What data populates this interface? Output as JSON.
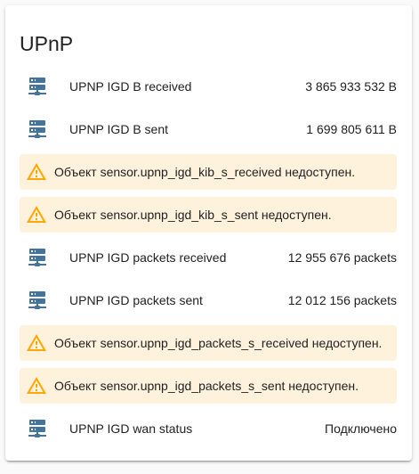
{
  "card": {
    "title": "UPnP"
  },
  "rows": [
    {
      "type": "entity",
      "icon": "server-network-icon",
      "label": "UPNP IGD B received",
      "value": "3 865 933 532 B"
    },
    {
      "type": "entity",
      "icon": "server-network-icon",
      "label": "UPNP IGD B sent",
      "value": "1 699 805 611 B"
    },
    {
      "type": "warning",
      "icon": "alert-triangle-icon",
      "text": "Объект sensor.upnp_igd_kib_s_received недоступен."
    },
    {
      "type": "warning",
      "icon": "alert-triangle-icon",
      "text": "Объект sensor.upnp_igd_kib_s_sent недоступен."
    },
    {
      "type": "entity",
      "icon": "server-network-icon",
      "label": "UPNP IGD packets received",
      "value": "12 955 676 packets"
    },
    {
      "type": "entity",
      "icon": "server-network-icon",
      "label": "UPNP IGD packets sent",
      "value": "12 012 156 packets"
    },
    {
      "type": "warning",
      "icon": "alert-triangle-icon",
      "text": "Объект sensor.upnp_igd_packets_s_received недоступен."
    },
    {
      "type": "warning",
      "icon": "alert-triangle-icon",
      "text": "Объект sensor.upnp_igd_packets_s_sent недоступен."
    },
    {
      "type": "entity",
      "icon": "server-network-icon",
      "label": "UPNP IGD wan status",
      "value": "Подключено"
    }
  ],
  "colors": {
    "entity_icon": "#44739e",
    "warning_icon": "#ffa600",
    "warning_bg": "#fef2dd"
  }
}
